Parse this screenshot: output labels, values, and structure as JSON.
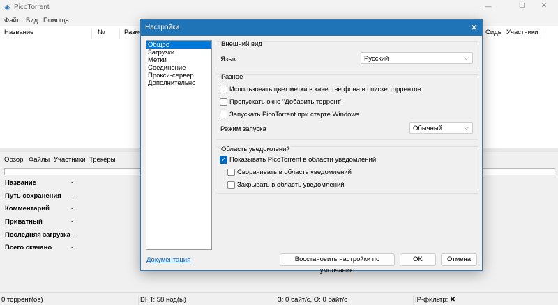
{
  "app": {
    "title": "PicoTorrent",
    "menu": [
      "Файл",
      "Вид",
      "Помощь"
    ],
    "window_controls": {
      "minimize": "—",
      "maximize": "☐",
      "close": "✕"
    }
  },
  "list": {
    "columns": [
      "Название",
      "№",
      "Разме",
      "Сиды",
      "Участники"
    ]
  },
  "details": {
    "tabs": [
      "Обзор",
      "Файлы",
      "Участники",
      "Трекеры"
    ],
    "rows": [
      {
        "label": "Название",
        "value": "-"
      },
      {
        "label": "Путь сохранения",
        "value": "-"
      },
      {
        "label": "Комментарий",
        "value": "-"
      },
      {
        "label": "Приватный",
        "value": "-"
      },
      {
        "label": "Последняя загрузка",
        "value": "-"
      },
      {
        "label": "Всего скачано",
        "value": "-"
      }
    ]
  },
  "status": {
    "torrents": "0 торрент(ов)",
    "dht": "DHT: 58 нод(ы)",
    "speed": "З: 0 байт/с, О: 0 байт/с",
    "ipfilter": "IP-фильтр:",
    "ipfilter_icon": "✕"
  },
  "dialog": {
    "title": "Настройки",
    "close": "✕",
    "nav": [
      "Общее",
      "Загрузки",
      "Метки",
      "Соединение",
      "Прокси-сервер",
      "Дополнительно"
    ],
    "appearance": {
      "label": "Внешний вид",
      "language_label": "Язык",
      "language_value": "Русский"
    },
    "misc": {
      "label": "Разное",
      "options": [
        {
          "label": "Использовать цвет метки в качестве фона в списке торрентов",
          "checked": false
        },
        {
          "label": "Пропускать окно \"Добавить торрент\"",
          "checked": false
        },
        {
          "label": "Запускать PicoTorrent при старте Windows",
          "checked": false
        }
      ],
      "startup_label": "Режим запуска",
      "startup_value": "Обычный"
    },
    "tray": {
      "label": "Область уведомлений",
      "options": [
        {
          "label": "Показывать PicoTorrent в области уведомлений",
          "checked": true
        },
        {
          "label": "Сворачивать в область уведомлений",
          "checked": false
        },
        {
          "label": "Закрывать в область уведомлений",
          "checked": false
        }
      ]
    },
    "docs_link": "Документация",
    "restore_button": "Восстановить настройки по умолчанию",
    "ok_button": "OK",
    "cancel_button": "Отмена"
  },
  "colors": {
    "accent": "#1f73b7",
    "selection": "#0078d7"
  }
}
